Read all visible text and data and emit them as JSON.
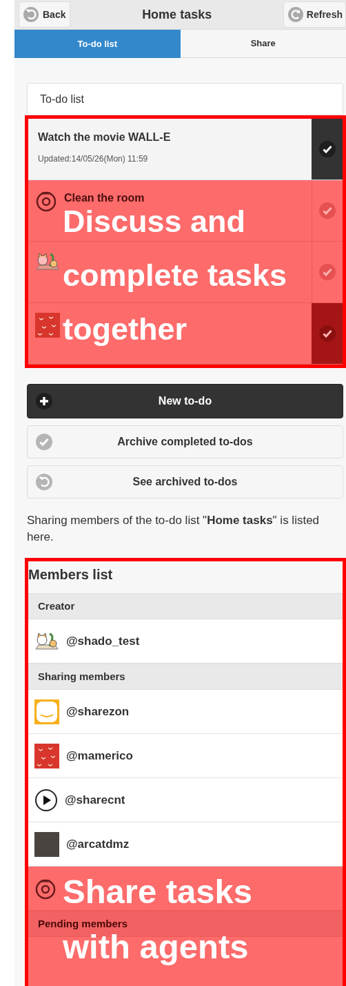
{
  "header": {
    "back": "Back",
    "title": "Home tasks",
    "refresh": "Refresh"
  },
  "tabs": [
    {
      "label": "To-do list",
      "selected": true
    },
    {
      "label": "Share",
      "selected": false
    }
  ],
  "todo": {
    "title": "To-do list",
    "caption": [
      "Discuss and",
      "complete tasks",
      "together"
    ],
    "items": [
      {
        "title": "Watch the movie WALL-E",
        "updated": "Updated:14/05/26(Mon) 11:59",
        "checked": true,
        "highlighted": false,
        "kind": "none"
      },
      {
        "title": "Clean the room",
        "checked": false,
        "highlighted": true,
        "kind": "ring"
      },
      {
        "checked": false,
        "highlighted": true,
        "kind": "cats"
      },
      {
        "checked": true,
        "highlighted": true,
        "kind": "pattern"
      }
    ]
  },
  "buttons": [
    {
      "label": "New to-do",
      "kind": "plus",
      "primary": true
    },
    {
      "label": "Archive completed to-dos",
      "kind": "check",
      "primary": false
    },
    {
      "label": "See archived to-dos",
      "kind": "undo",
      "primary": false
    }
  ],
  "sharing_note": "Sharing members of the to-do list \"**Home tasks**\" is listed here.",
  "members": {
    "title": "Members list",
    "caption": [
      "Share tasks",
      "with agents"
    ],
    "sections": [
      {
        "title": "Creator",
        "highlighted": false,
        "members": [
          {
            "handle": "@shado_test",
            "kind": "cats",
            "highlighted": false
          }
        ]
      },
      {
        "title": "Sharing members",
        "highlighted": false,
        "members": [
          {
            "handle": "@sharezon",
            "kind": "smiley",
            "highlighted": false
          },
          {
            "handle": "@mamerico",
            "kind": "pattern",
            "highlighted": false
          },
          {
            "handle": "@sharecnt",
            "kind": "play",
            "highlighted": false
          },
          {
            "handle": "@arcatdmz",
            "kind": "photo",
            "highlighted": false
          },
          {
            "kind": "ring",
            "highlighted": true
          }
        ]
      },
      {
        "title": "Pending members",
        "highlighted": true
      }
    ]
  }
}
